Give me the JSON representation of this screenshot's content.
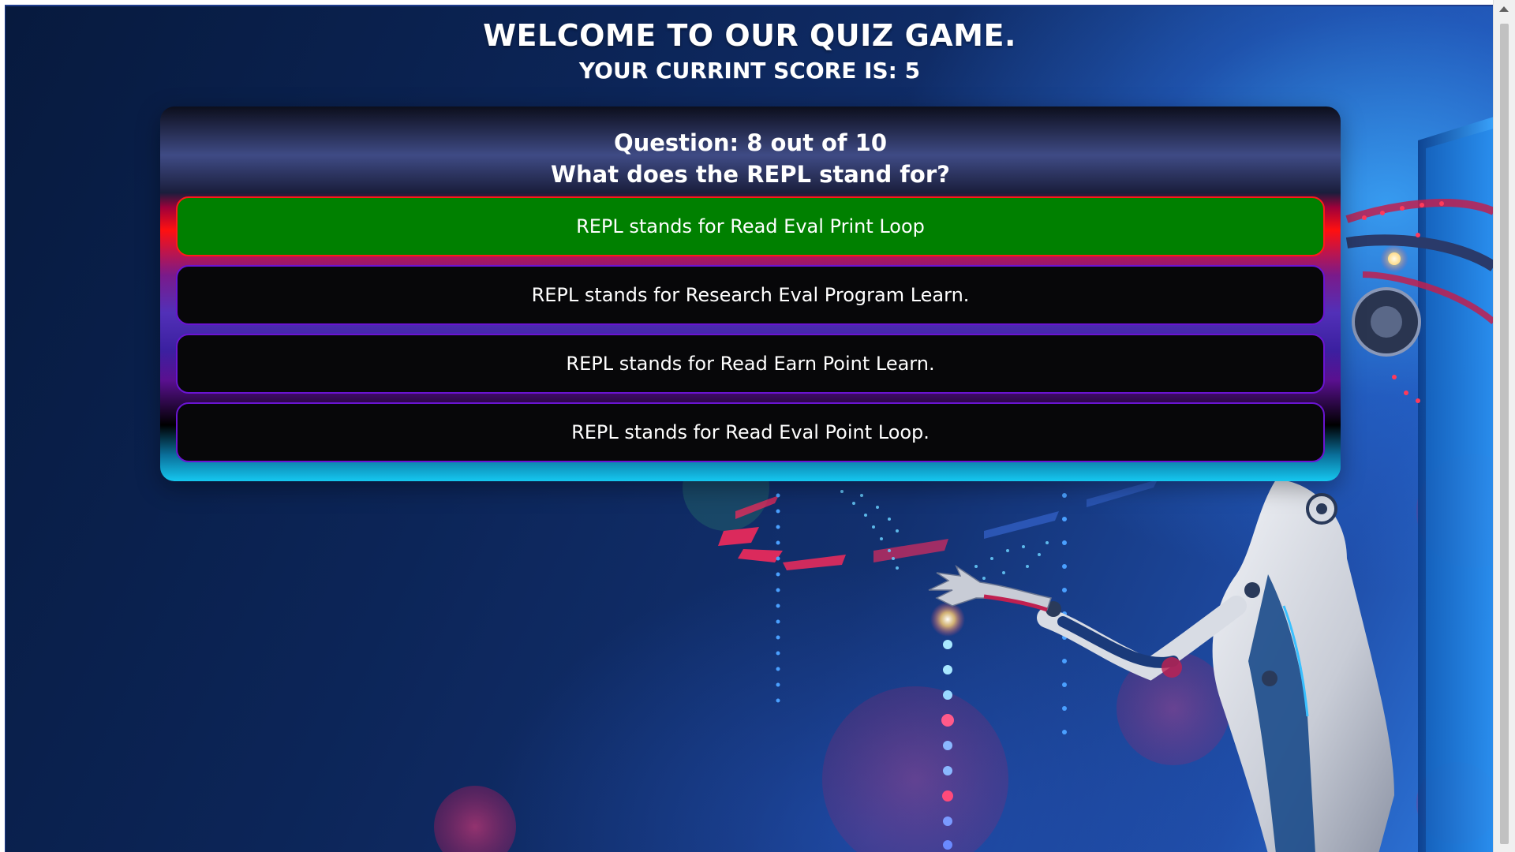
{
  "header": {
    "title": "WELCOME TO OUR QUIZ GAME.",
    "score_text": "YOUR CURRINT SCORE IS: 5"
  },
  "quiz": {
    "question_number_text": "Question: 8 out of 10",
    "question_text": "What does the REPL stand for?",
    "answers": [
      {
        "label": "REPL stands for Read Eval Print Loop",
        "state": "correct"
      },
      {
        "label": "REPL stands for Research Eval Program Learn.",
        "state": "default"
      },
      {
        "label": "REPL stands for Read Earn Point Learn.",
        "state": "default"
      },
      {
        "label": "REPL stands for Read Eval Point Loop.",
        "state": "default"
      }
    ]
  },
  "colors": {
    "correct_answer_bg": "#008000",
    "correct_answer_border": "#ff1a1a",
    "answer_bg": "#070709",
    "answer_border": "#6a14d2",
    "page_bg": "#0c2558"
  },
  "icons": {
    "scroll_up": "scroll-up-arrow-icon",
    "background": "robot-illustration"
  }
}
